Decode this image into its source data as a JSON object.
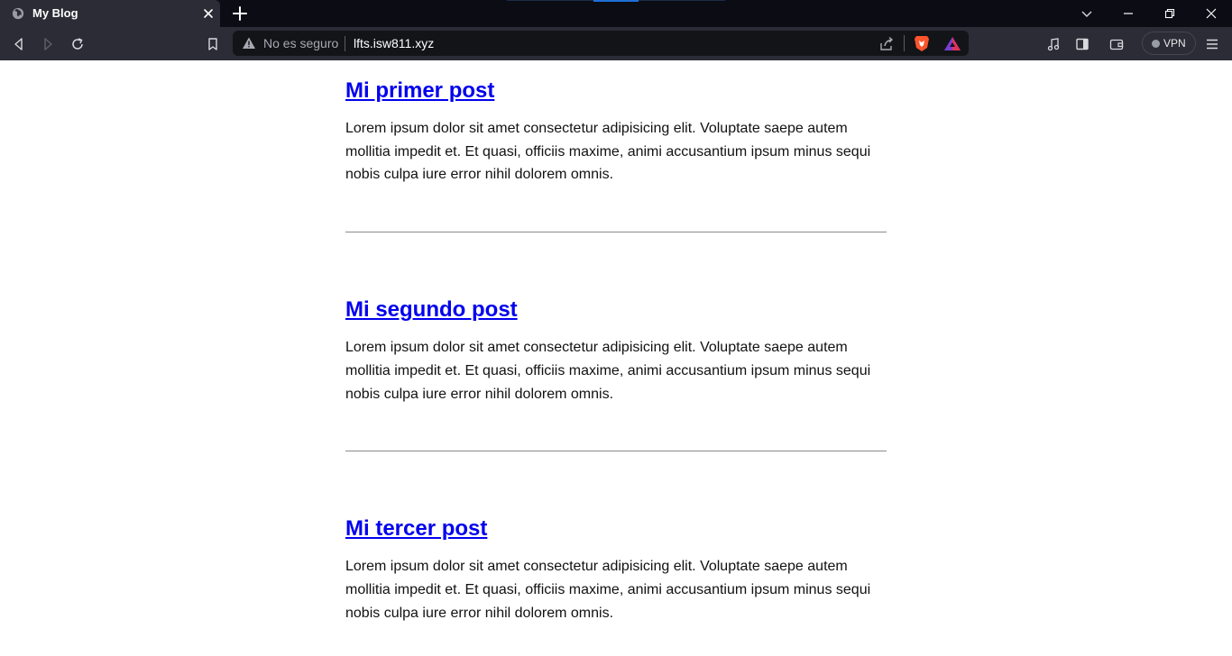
{
  "browser": {
    "tab": {
      "title": "My Blog"
    },
    "address": {
      "security_label": "No es seguro",
      "url": "lfts.isw811.xyz"
    },
    "vpn_label": "VPN",
    "accent": "#1f6fd6"
  },
  "posts": [
    {
      "title": "Mi primer post",
      "body": "Lorem ipsum dolor sit amet consectetur adipisicing elit. Voluptate saepe autem mollitia impedit et. Et quasi, officiis maxime, animi accusantium ipsum minus sequi nobis culpa iure error nihil dolorem omnis."
    },
    {
      "title": "Mi segundo post",
      "body": "Lorem ipsum dolor sit amet consectetur adipisicing elit. Voluptate saepe autem mollitia impedit et. Et quasi, officiis maxime, animi accusantium ipsum minus sequi nobis culpa iure error nihil dolorem omnis."
    },
    {
      "title": "Mi tercer post",
      "body": "Lorem ipsum dolor sit amet consectetur adipisicing elit. Voluptate saepe autem mollitia impedit et. Et quasi, officiis maxime, animi accusantium ipsum minus sequi nobis culpa iure error nihil dolorem omnis."
    }
  ],
  "link_color": "#0000ee"
}
